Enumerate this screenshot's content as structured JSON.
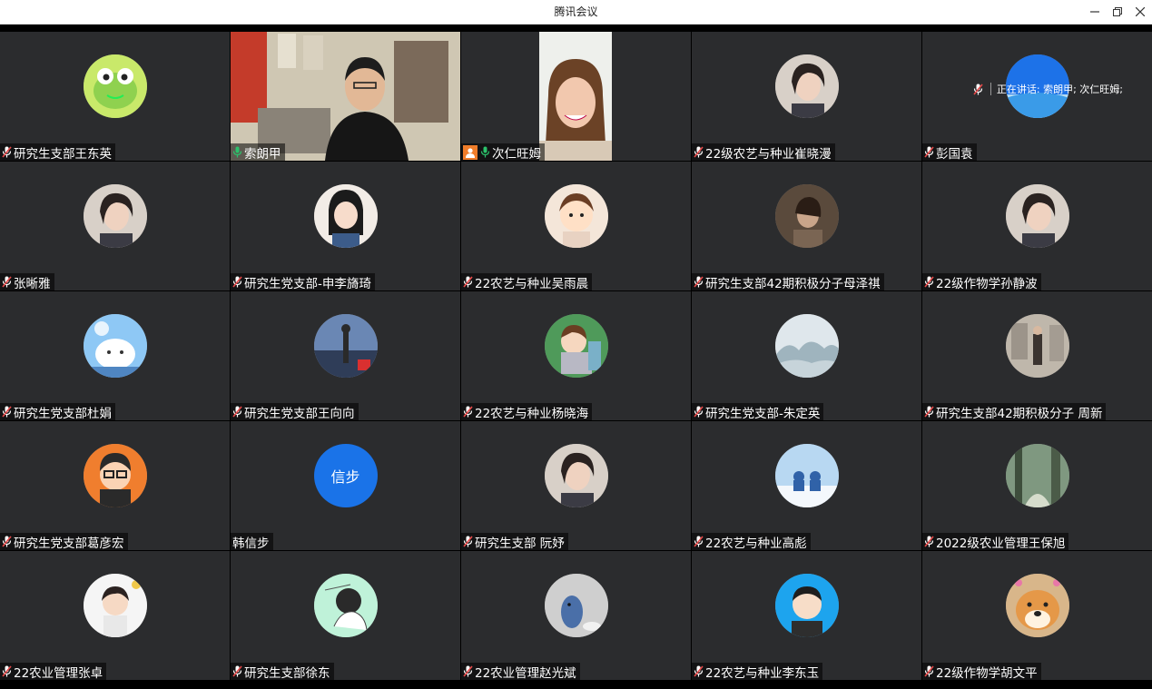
{
  "window": {
    "title": "腾讯会议"
  },
  "speaking": {
    "label": "正在讲话: 索朗甲; 次仁旺姆;"
  },
  "colors": {
    "tile_bg": "#2b2c2e",
    "active_border": "#25b05f",
    "mic_on": "#2bc26b",
    "mic_off": "#e84a4a",
    "host_badge": "#f07d2a",
    "avatar_blue": "#1a73e8"
  },
  "participants": [
    {
      "name": "研究生支部王东英",
      "mic": "muted",
      "avatar": "frog"
    },
    {
      "name": "索朗甲",
      "mic": "on",
      "video": true
    },
    {
      "name": "次仁旺姆",
      "mic": "on",
      "video": true,
      "host": true
    },
    {
      "name": "22级农艺与种业崔晓漫",
      "mic": "muted",
      "avatar": "photo"
    },
    {
      "name": "彭国袁",
      "mic": "muted",
      "avatar": "sky"
    },
    {
      "name": "张晰雅",
      "mic": "muted",
      "avatar": "photo"
    },
    {
      "name": "研究生党支部-申李旖琦",
      "mic": "muted",
      "avatar": "illustration"
    },
    {
      "name": "22农艺与种业吴雨晨",
      "mic": "muted",
      "avatar": "cartoon"
    },
    {
      "name": "研究生支部42期积极分子母泽祺",
      "mic": "muted",
      "avatar": "photo-dark"
    },
    {
      "name": "22级作物学孙静波",
      "mic": "muted",
      "avatar": "photo"
    },
    {
      "name": "研究生党支部杜娟",
      "mic": "muted",
      "avatar": "cat"
    },
    {
      "name": "研究生党支部王向向",
      "mic": "muted",
      "avatar": "sunset"
    },
    {
      "name": "22农艺与种业杨晓海",
      "mic": "muted",
      "avatar": "cartoon-boy"
    },
    {
      "name": "研究生党支部-朱定英",
      "mic": "muted",
      "avatar": "landscape"
    },
    {
      "name": "研究生支部42期积极分子  周新",
      "mic": "muted",
      "avatar": "street"
    },
    {
      "name": "研究生党支部葛彦宏",
      "mic": "muted",
      "avatar": "cartoon-glasses"
    },
    {
      "name": "韩信步",
      "mic": "none",
      "avatar": "text",
      "avatar_text": "信步"
    },
    {
      "name": "研究生支部 阮妤",
      "mic": "muted",
      "avatar": "photo"
    },
    {
      "name": "22农艺与种业高彪",
      "mic": "muted",
      "avatar": "snow"
    },
    {
      "name": "2022级农业管理王保旭",
      "mic": "muted",
      "avatar": "forest"
    },
    {
      "name": "22农业管理张卓",
      "mic": "muted",
      "avatar": "child"
    },
    {
      "name": "研究生支部徐东",
      "mic": "muted",
      "avatar": "sketch"
    },
    {
      "name": "22农业管理赵光斌",
      "mic": "muted",
      "avatar": "toy"
    },
    {
      "name": "22农艺与种业李东玉",
      "mic": "muted",
      "avatar": "boy-blue"
    },
    {
      "name": "22级作物学胡文平",
      "mic": "muted",
      "avatar": "dog"
    }
  ]
}
